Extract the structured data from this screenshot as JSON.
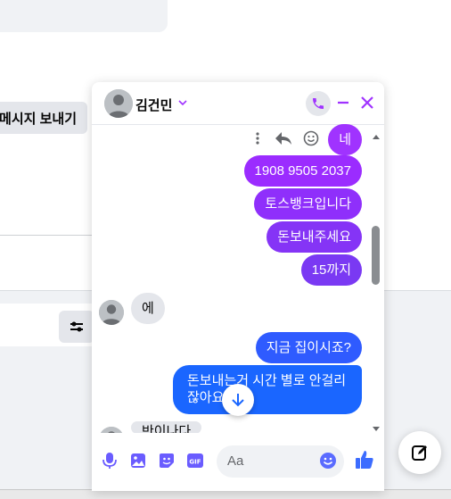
{
  "background": {
    "send_message_label": "메시지 보내기"
  },
  "chat": {
    "contact_name": "김건민",
    "messages_right": [
      {
        "text": "네",
        "color": "#a033ff"
      },
      {
        "text": "1908 9505 2037",
        "color": "#9b2cff"
      },
      {
        "text": "토스뱅크입니다",
        "color": "#8f2ffb"
      },
      {
        "text": "돈보내주세요",
        "color": "#8534f6"
      },
      {
        "text": "15까지",
        "color": "#7a39f3"
      }
    ],
    "incoming_1": "에",
    "messages_right_2": [
      {
        "text": "지금 집이시죠?",
        "color": "#2f5bff"
      },
      {
        "text_line1": "돈보내는거 시간 별로 안걸리",
        "text_line2": "잖아요",
        "color": "#1a66ff"
      }
    ],
    "incoming_2": "반이나다"
  },
  "composer": {
    "placeholder": "Aa"
  },
  "colors": {
    "accent": "#a033ff",
    "icon_blue": "#0a7cff"
  }
}
